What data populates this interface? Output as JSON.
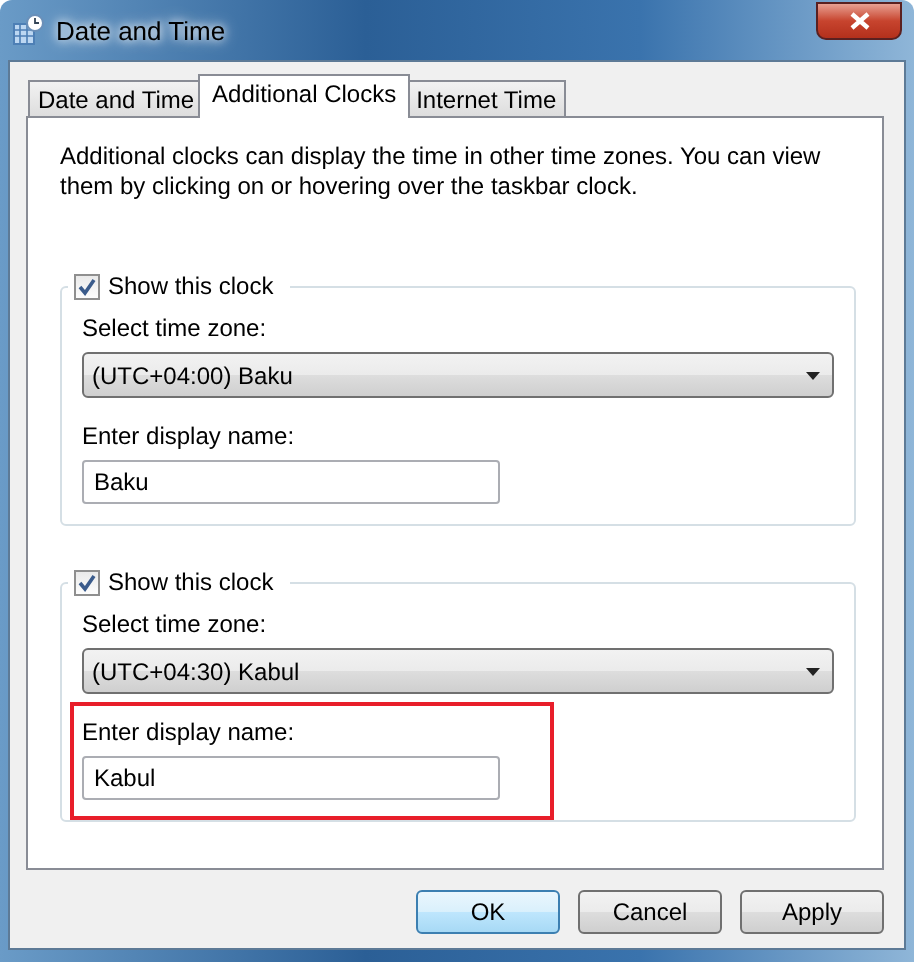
{
  "window": {
    "title": "Date and Time"
  },
  "tabs": [
    {
      "label": "Date and Time",
      "selected": false
    },
    {
      "label": "Additional Clocks",
      "selected": true
    },
    {
      "label": "Internet Time",
      "selected": false
    }
  ],
  "description": "Additional clocks can display the time in other time zones. You can view them by clicking on or hovering over the taskbar clock.",
  "clocks": [
    {
      "show_label": "Show this clock",
      "checked": true,
      "zone_label": "Select time zone:",
      "zone": "(UTC+04:00) Baku",
      "name_label": "Enter display name:",
      "name": "Baku",
      "highlighted": false
    },
    {
      "show_label": "Show this clock",
      "checked": true,
      "zone_label": "Select time zone:",
      "zone": "(UTC+04:30) Kabul",
      "name_label": "Enter display name:",
      "name": "Kabul",
      "highlighted": true
    }
  ],
  "buttons": [
    {
      "label": "OK",
      "default": true
    },
    {
      "label": "Cancel",
      "default": false
    },
    {
      "label": "Apply",
      "default": false
    }
  ]
}
